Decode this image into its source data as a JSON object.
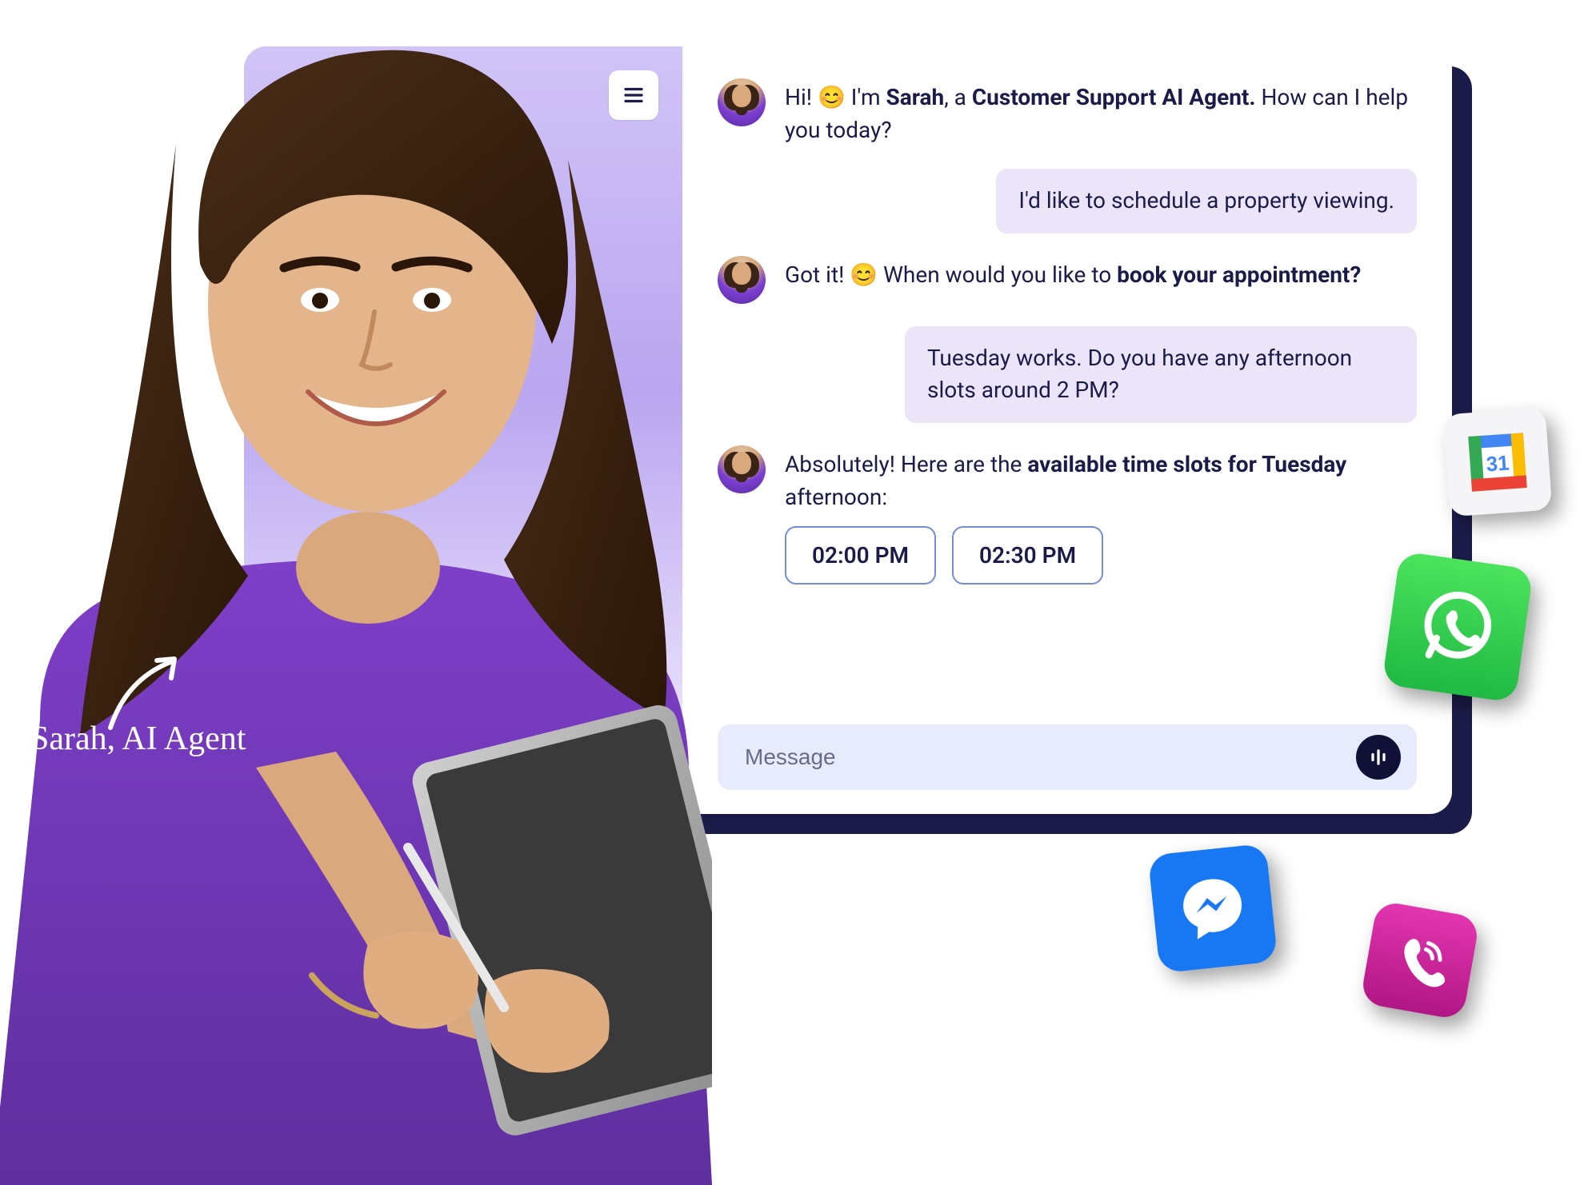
{
  "agent": {
    "name": "Sarah",
    "role": "Customer Support AI Agent"
  },
  "annotation": {
    "label": "Sarah, AI Agent"
  },
  "header": {
    "menu_icon": "hamburger-icon"
  },
  "messages": {
    "m1": {
      "prefix": "Hi! 😊 I'm ",
      "name": "Sarah",
      "mid": ", a ",
      "role": "Customer Support AI Agent.",
      "suffix": " How can I help you today?"
    },
    "u1": "I'd like to schedule a property viewing.",
    "m2": {
      "prefix": "Got it! 😊 When would you like to ",
      "bold": "book your appointment?"
    },
    "u2": "Tuesday works. Do you have any afternoon slots around 2 PM?",
    "m3": {
      "prefix": "Absolutely! Here are the ",
      "bold": "available time slots for Tuesday",
      "suffix": " afternoon:"
    }
  },
  "slots": {
    "s1": "02:00 PM",
    "s2": "02:30 PM"
  },
  "composer": {
    "placeholder": "Message",
    "voice_icon": "voice-waveform-icon"
  },
  "integrations": {
    "calendar": {
      "name": "google-calendar-icon",
      "day": "31"
    },
    "whatsapp": {
      "name": "whatsapp-icon"
    },
    "messenger": {
      "name": "messenger-icon"
    },
    "viber": {
      "name": "phone-icon"
    }
  },
  "colors": {
    "navy": "#1b1b4a",
    "purple_light": "#ece4f9",
    "composer_bg": "#e7ebfb",
    "slot_border": "#738bd8",
    "whatsapp": "#25d366",
    "messenger": "#1877f2",
    "viber": "#d6249f"
  }
}
